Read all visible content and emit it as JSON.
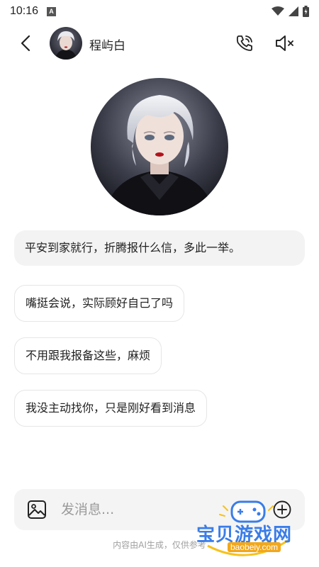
{
  "status_bar": {
    "time": "10:16",
    "notification_letter": "A"
  },
  "header": {
    "contact_name": "程屿白"
  },
  "messages": [
    {
      "text": "平安到家就行，折腾报什么信，多此一举。"
    },
    {
      "text": "嘴挺会说，实际顾好自己了吗"
    },
    {
      "text": "不用跟我报备这些，麻烦"
    },
    {
      "text": "我没主动找你，只是刚好看到消息"
    }
  ],
  "input": {
    "placeholder": "发消息..."
  },
  "footer": {
    "note": "内容由AI生成，仅供参考"
  },
  "watermark": {
    "title": "宝贝游戏网",
    "url": "baobeiy.com"
  },
  "colors": {
    "bubble_highlight": "#f3f3f3",
    "input_bg": "#f4f4f4",
    "watermark_blue": "#3a7de8",
    "watermark_orange": "#f2a71b"
  },
  "icons": [
    "back-arrow-icon",
    "phone-icon",
    "speaker-muted-icon",
    "image-icon",
    "plus-circle-icon",
    "wifi-icon",
    "signal-icon",
    "battery-icon"
  ]
}
